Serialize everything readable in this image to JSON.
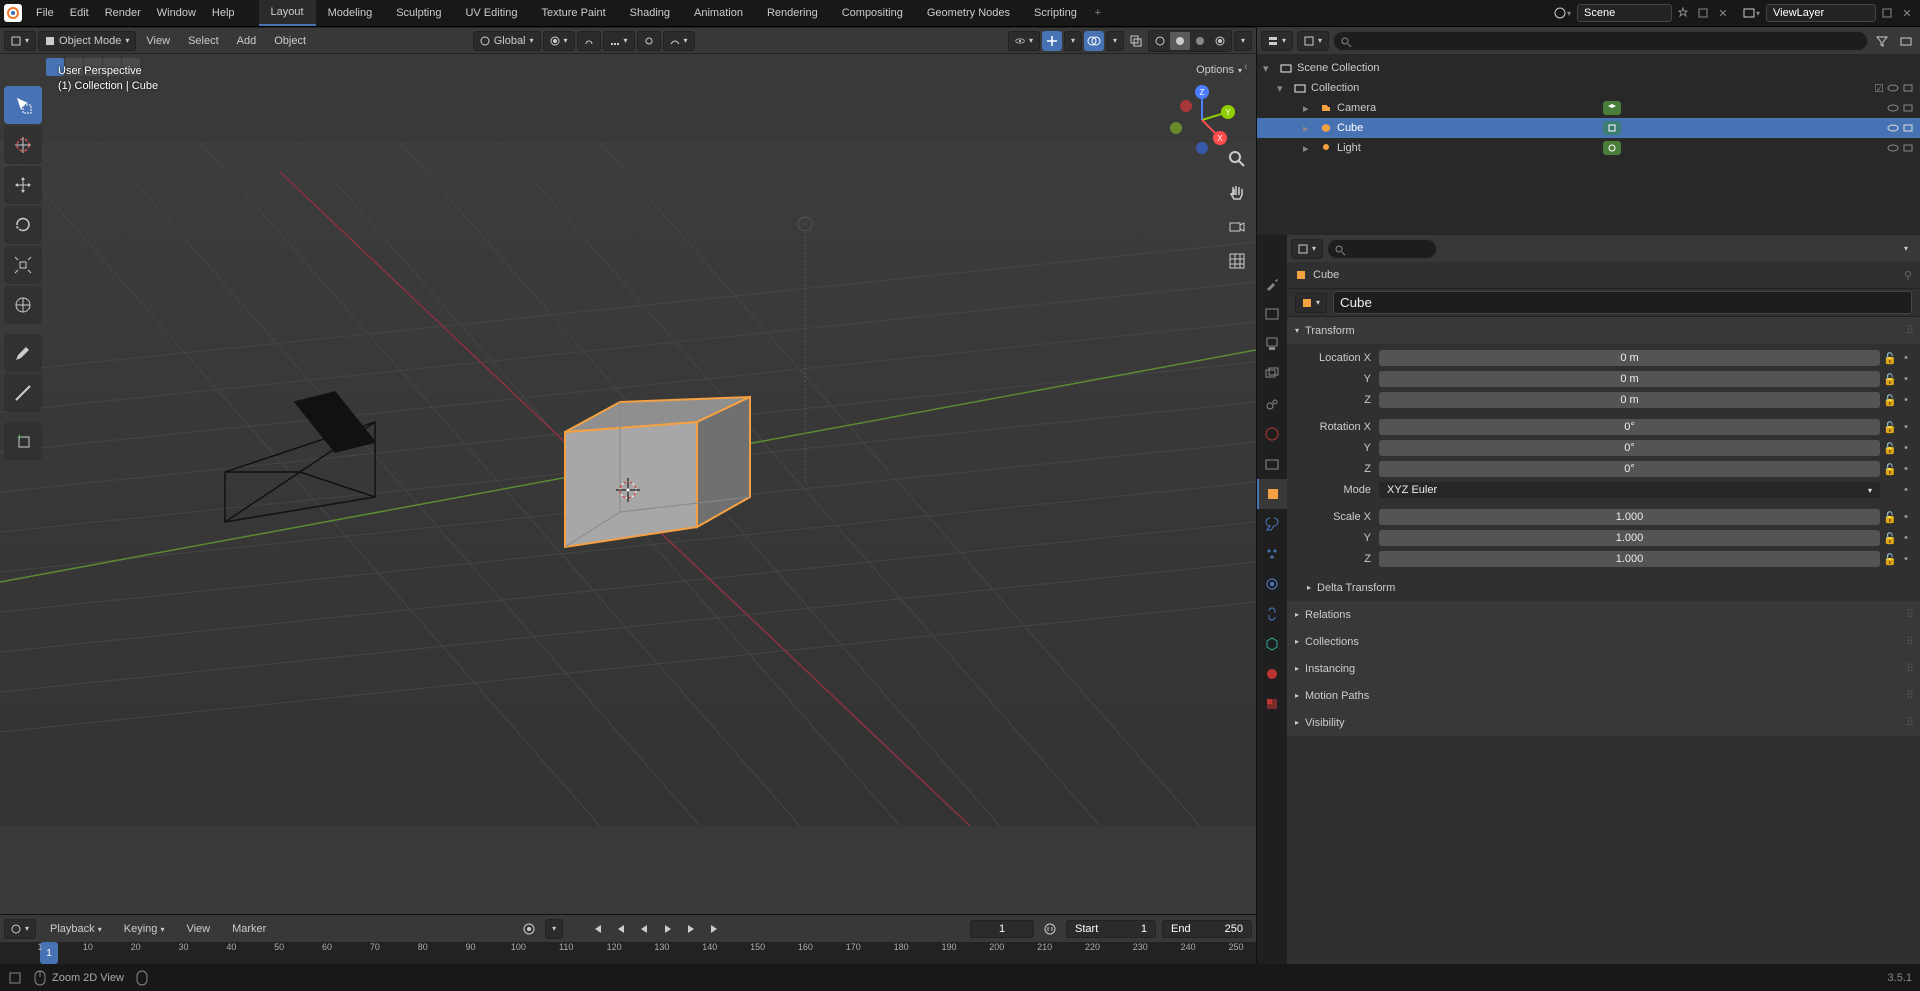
{
  "app": {
    "name": "Blender"
  },
  "menus": [
    "File",
    "Edit",
    "Render",
    "Window",
    "Help"
  ],
  "workspaces": [
    "Layout",
    "Modeling",
    "Sculpting",
    "UV Editing",
    "Texture Paint",
    "Shading",
    "Animation",
    "Rendering",
    "Compositing",
    "Geometry Nodes",
    "Scripting"
  ],
  "active_workspace": 0,
  "scene": {
    "label": "Scene",
    "layer_label": "ViewLayer"
  },
  "viewport_header": {
    "mode": "Object Mode",
    "menus": [
      "View",
      "Select",
      "Add",
      "Object"
    ],
    "orientation": "Global",
    "options_label": "Options"
  },
  "viewport_overlay": {
    "line1": "User Perspective",
    "line2": "(1) Collection | Cube"
  },
  "timeline": {
    "menus": [
      "Playback",
      "Keying",
      "View",
      "Marker"
    ],
    "current_frame": "1",
    "start_label": "Start",
    "start_val": "1",
    "end_label": "End",
    "end_val": "250",
    "frame_box": "1",
    "ticks": [
      "1",
      "10",
      "20",
      "30",
      "40",
      "50",
      "60",
      "70",
      "80",
      "90",
      "100",
      "110",
      "120",
      "130",
      "140",
      "150",
      "160",
      "170",
      "180",
      "190",
      "200",
      "210",
      "220",
      "230",
      "240",
      "250"
    ]
  },
  "outliner": {
    "root": "Scene Collection",
    "collection": "Collection",
    "items": [
      {
        "name": "Camera",
        "icon": "camera",
        "selected": false
      },
      {
        "name": "Cube",
        "icon": "mesh",
        "selected": true
      },
      {
        "name": "Light",
        "icon": "light",
        "selected": false
      }
    ]
  },
  "properties": {
    "crumb": "Cube",
    "name_field": "Cube",
    "panels": {
      "transform": {
        "title": "Transform",
        "loc_label": "Location X",
        "loc": {
          "x": "0 m",
          "y": "0 m",
          "z": "0 m"
        },
        "rot_label": "Rotation X",
        "rot": {
          "x": "0°",
          "y": "0°",
          "z": "0°"
        },
        "mode_label": "Mode",
        "mode_val": "XYZ Euler",
        "scale_label": "Scale X",
        "scale": {
          "x": "1.000",
          "y": "1.000",
          "z": "1.000"
        },
        "delta": "Delta Transform"
      },
      "collapsed": [
        "Relations",
        "Collections",
        "Instancing",
        "Motion Paths",
        "Visibility"
      ]
    }
  },
  "status": {
    "hint": "Zoom 2D View",
    "version": "3.5.1"
  }
}
